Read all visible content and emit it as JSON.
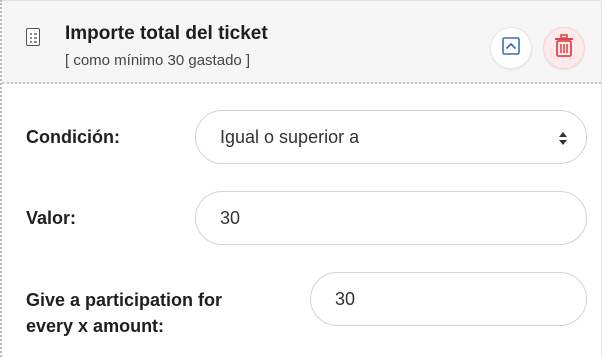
{
  "header": {
    "title": "Importe total del ticket",
    "subtitle": "[ como mínimo 30 gastado ]",
    "icon": "receipt-icon",
    "collapse_icon": "chevron-up-icon",
    "delete_icon": "trash-icon",
    "delete_color": "#e0474c"
  },
  "condition": {
    "label": "Condición:",
    "selected": "Igual o superior a"
  },
  "value": {
    "label": "Valor:",
    "value": "30"
  },
  "participation": {
    "label_line1": "Give a participation for",
    "label_line2": "every x amount:",
    "value": "30"
  }
}
